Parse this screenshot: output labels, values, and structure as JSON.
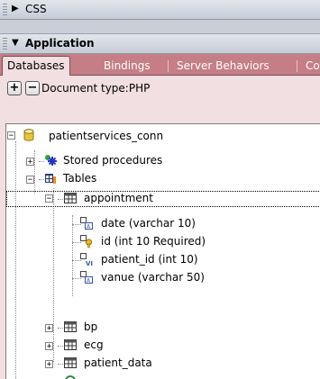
{
  "panels": {
    "css": {
      "title": "CSS"
    },
    "application": {
      "title": "Application"
    }
  },
  "tabs": [
    "Databases",
    "Bindings",
    "Server Behaviors",
    "Co"
  ],
  "toolbar": {
    "add_label": "+",
    "remove_label": "−",
    "doc_type": "Document type:PHP"
  },
  "tree": {
    "connection": "patientservices_conn",
    "stored_procedures": "Stored procedures",
    "tables": "Tables",
    "appointment": "appointment",
    "columns": [
      "date (varchar 10)",
      "id (int 10 Required)",
      "patient_id (int 10)",
      "vanue (varchar 50)"
    ],
    "other_tables": [
      "bp",
      "ecg",
      "patient_data"
    ]
  },
  "colors": {
    "accent": "#c57e86",
    "panel_bg": "#f2dfe1"
  }
}
